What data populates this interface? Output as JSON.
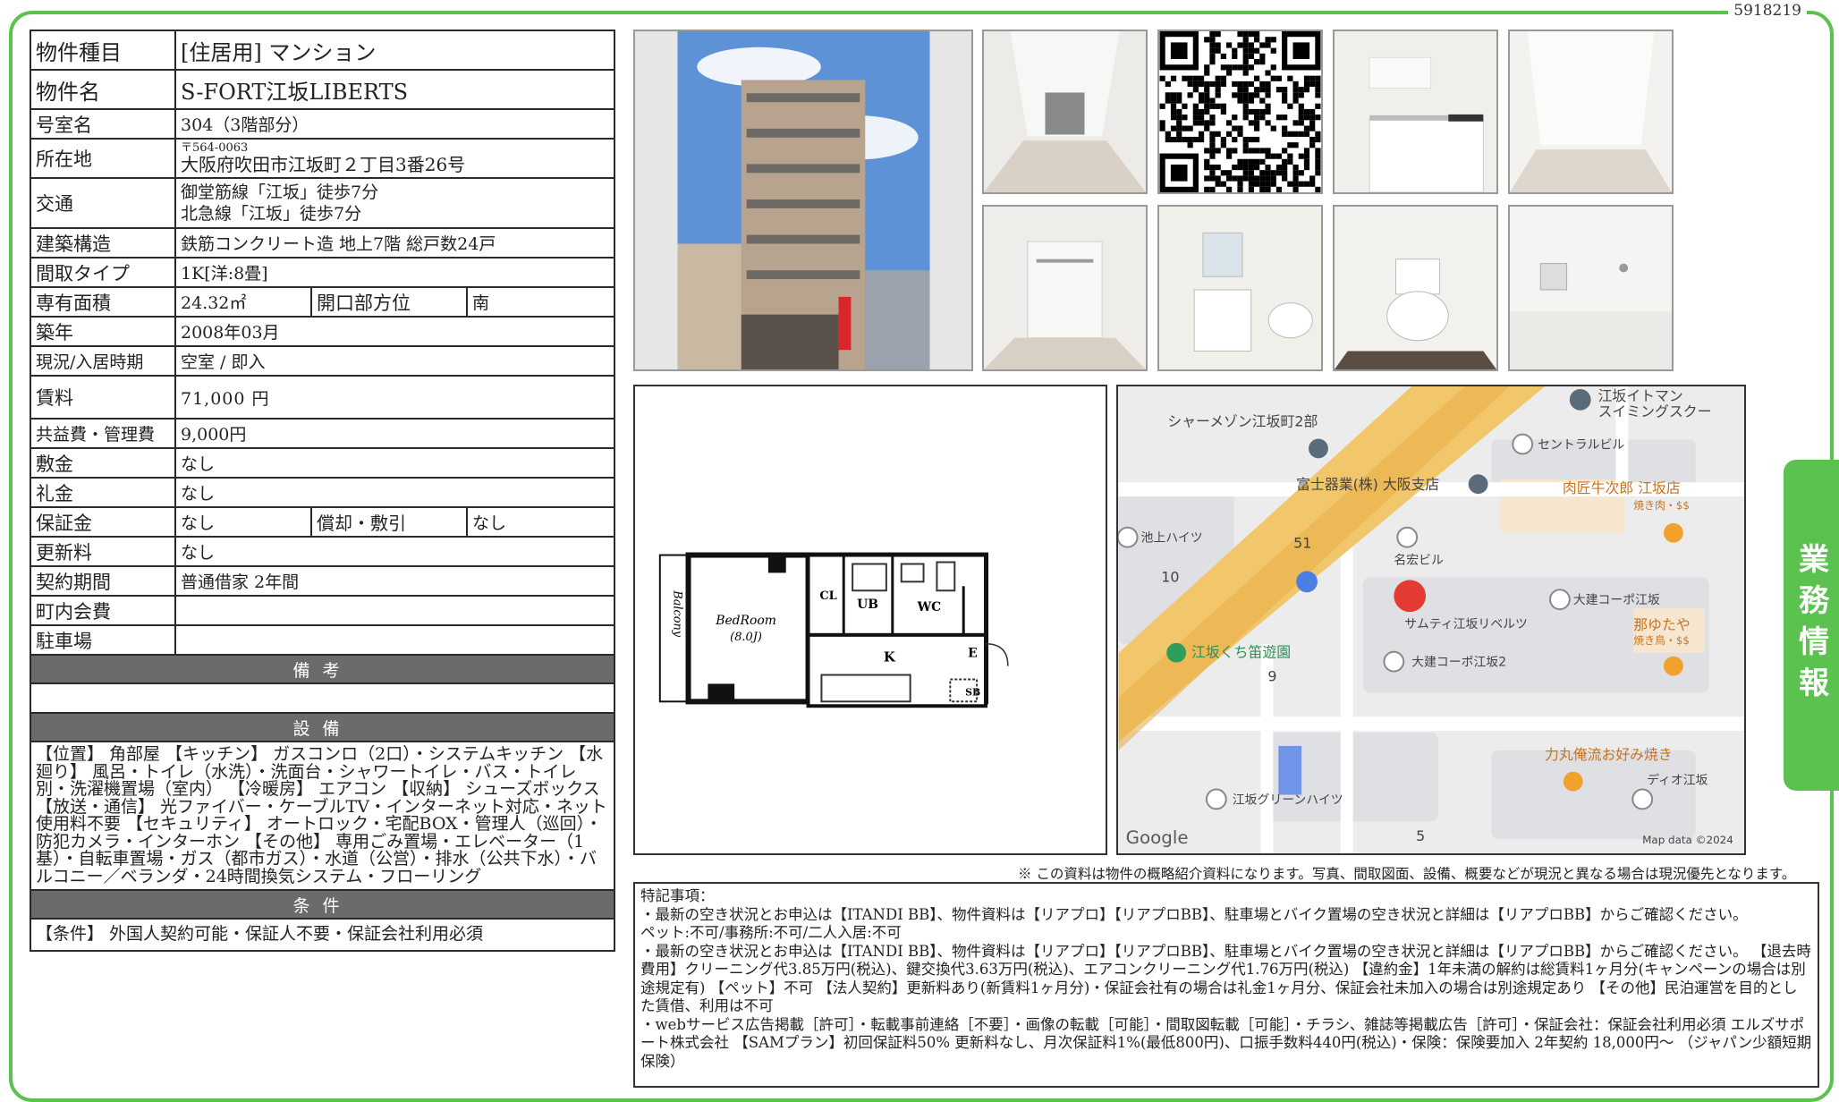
{
  "doc_code": "5918219",
  "side_tab": "業務情報",
  "spec": {
    "type_label": "物件種目",
    "type_value": "[住居用] マンション",
    "name_label": "物件名",
    "name_value": "S-FORT江坂LIBERTS",
    "room_label": "号室名",
    "room_value": "304（3階部分）",
    "address_label": "所在地",
    "zip": "〒564-0063",
    "address": "大阪府吹田市江坂町２丁目3番26号",
    "access_label": "交通",
    "access_1": "御堂筋線「江坂」徒歩7分",
    "access_2": "北急線「江坂」徒歩7分",
    "structure_label": "建築構造",
    "structure_value": "鉄筋コンクリート造 地上7階 総戸数24戸",
    "layout_label": "間取タイプ",
    "layout_value": "1K[洋:8畳]",
    "area_label": "専有面積",
    "area_value": "24.32㎡",
    "direction_label": "開口部方位",
    "direction_value": "南",
    "built_label": "築年",
    "built_value": "2008年03月",
    "status_label": "現況/入居時期",
    "status_value": "空室 / 即入",
    "rent_label": "賃料",
    "rent_value": "71,000 円",
    "fee_label": "共益費・管理費",
    "fee_value": "9,000円",
    "deposit_label": "敷金",
    "deposit_value": "なし",
    "key_money_label": "礼金",
    "key_money_value": "なし",
    "guarantee_label": "保証金",
    "guarantee_value": "なし",
    "amort_label": "償却・敷引",
    "amort_value": "なし",
    "renewal_label": "更新料",
    "renewal_value": "なし",
    "contract_label": "契約期間",
    "contract_value": "普通借家 2年間",
    "town_label": "町内会費",
    "town_value": "",
    "parking_label": "駐車場",
    "parking_value": ""
  },
  "sections": {
    "notes_head": "備考",
    "facility_head": "設備",
    "facility_text": "【位置】 角部屋 【キッチン】 ガスコンロ（2口）・システムキッチン 【水廻り】 風呂・トイレ（水洗）・洗面台・シャワートイレ・バス・トイレ別・洗濯機置場（室内） 【冷暖房】 エアコン 【収納】 シューズボックス 【放送・通信】 光ファイバー・ケーブルTV・インターネット対応・ネット使用料不要 【セキュリティ】 オートロック・宅配BOX・管理人（巡回）・防犯カメラ・インターホン 【その他】 専用ごみ置場・エレベーター（1基）・自転車置場・ガス（都市ガス）・水道（公営）・排水（公共下水）・バルコニー／ベランダ・24時間換気システム・フローリング",
    "conditions_head": "条件",
    "conditions_text": "【条件】 外国人契約可能・保証人不要・保証会社利用必須"
  },
  "floorplan": {
    "balcony": "Balcony",
    "bedroom": "BedRoom",
    "bedroom_size": "(8.0J)",
    "cl": "CL",
    "ub": "UB",
    "wc": "WC",
    "k": "K",
    "e": "E",
    "sb": "SB"
  },
  "map": {
    "labels": {
      "l1": "江坂イトマン",
      "l1b": "スイミングスクー",
      "l2": "シャーメゾン江坂町2部",
      "l3": "セントラルビル",
      "l4": "富士器業(株) 大阪支店",
      "l5": "肉匠牛次郎 江坂店",
      "l5b": "焼き肉・$$",
      "l6": "池上ハイツ",
      "l7": "名宏ビル",
      "l8": "大建コーポ江坂",
      "l9": "サムティ江坂リベルツ",
      "l10": "那ゆたや",
      "l10b": "焼き鳥・$$",
      "l11": "江坂くち笛遊園",
      "l12": "大建コーポ江坂2",
      "l13": "力丸俺流お好み焼き",
      "l14": "ディオ江坂",
      "l15": "江坂グリーンハイツ",
      "n51": "51",
      "n10": "10",
      "n9": "9",
      "n5": "5"
    },
    "google": "Google",
    "map_data": "Map data ©2024"
  },
  "disclaimer": "※ この資料は物件の概略紹介資料になります。写真、間取図面、設備、概要などが現況と異なる場合は現況優先となります。",
  "remarks": [
    "特記事項：",
    "・最新の空き状況とお申込は【ITANDI BB】、物件資料は【リアプロ】【リアプロBB】、駐車場とバイク置場の空き状況と詳細は【リアプロBB】からご確認ください。",
    "ペット:不可/事務所:不可/二人入居:不可",
    "・最新の空き状況とお申込は【ITANDI BB】、物件資料は【リアプロ】【リアプロBB】、駐車場とバイク置場の空き状況と詳細は【リアプロBB】からご確認ください。 【退去時費用】クリーニング代3.85万円(税込)、鍵交換代3.63万円(税込)、エアコンクリーニング代1.76万円(税込) 【違約金】1年未満の解約は総賃料1ヶ月分(キャンペーンの場合は別途規定有) 【ペット】不可 【法人契約】更新料あり(新賃料1ヶ月分)・保証会社有の場合は礼金1ヶ月分、保証会社未加入の場合は別途規定あり 【その他】民泊運営を目的とした賃借、利用は不可",
    "・webサービス広告掲載［許可］・転載事前連絡［不要］・画像の転載［可能］・間取図転載［可能］・チラシ、雑誌等掲載広告［許可］・保証会社：保証会社利用必須 エルズサポート株式会社 【SAMプラン】初回保証料50% 更新料なし、月次保証料1%(最低800円)、口振手数料440円(税込)・保険：保険要加入 2年契約 18,000円～ （ジャパン少額短期保険）"
  ],
  "colors": {
    "frame": "#5cc24f",
    "section_head": "#6b6b6b"
  }
}
